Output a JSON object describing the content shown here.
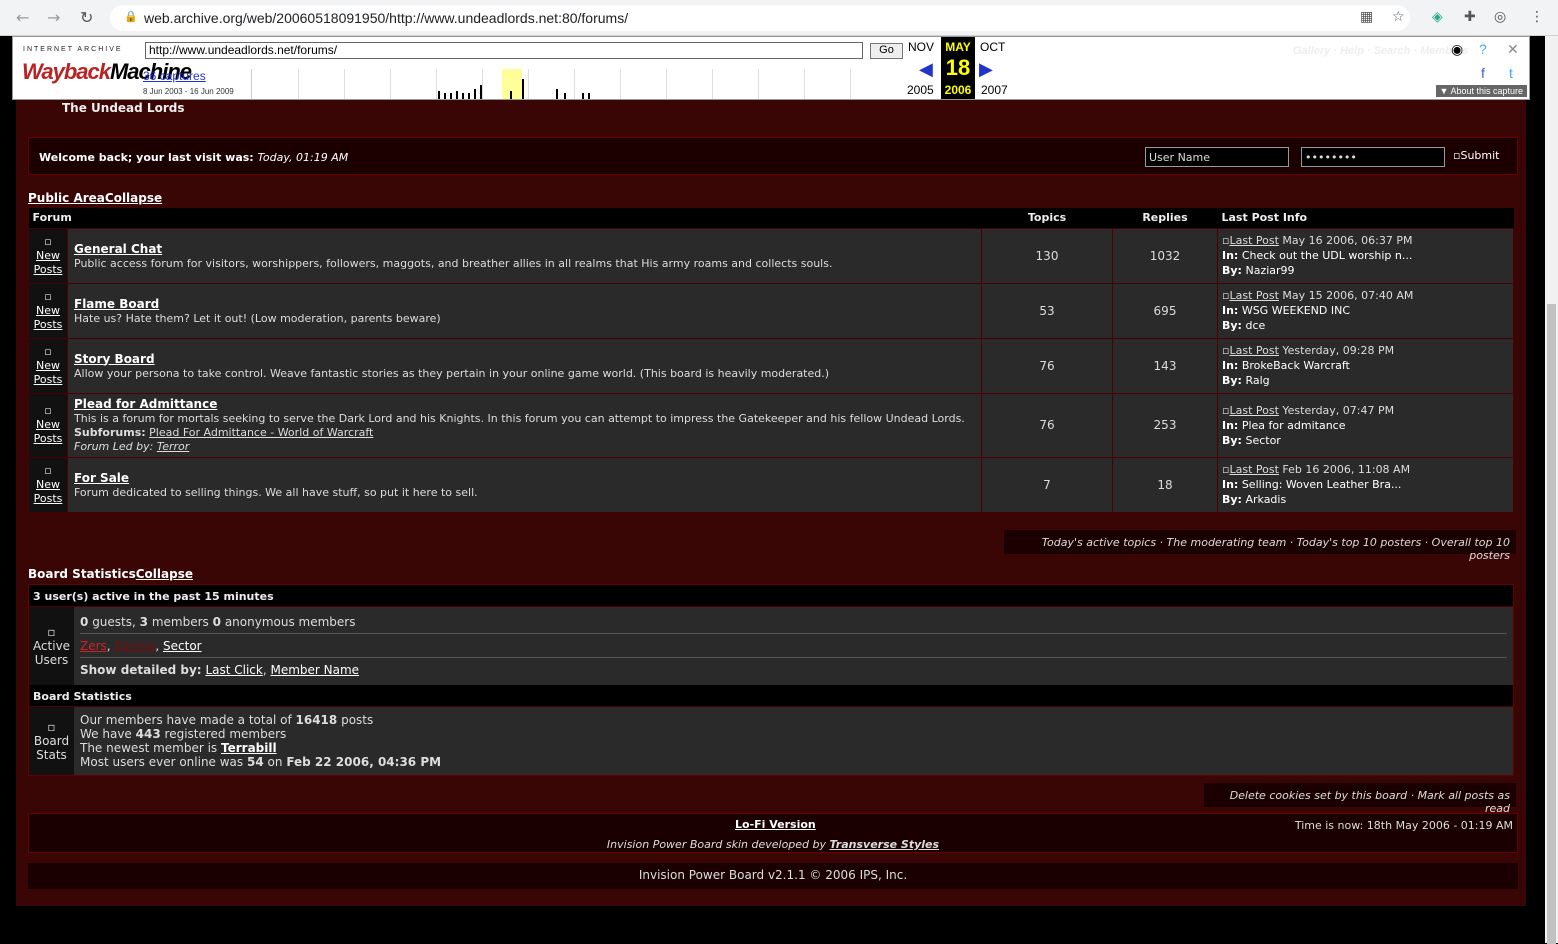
{
  "browser": {
    "url": "web.archive.org/web/20060518091950/http://www.undeadlords.net:80/forums/"
  },
  "wayback": {
    "ia_label": "INTERNET ARCHIVE",
    "logo_a": "Wayback",
    "logo_b": "Machine",
    "url_input": "http://www.undeadlords.net/forums/",
    "go": "Go",
    "captures": "36 captures",
    "range": "8 Jun 2003 - 16 Jun 2009",
    "prev_month": "NOV",
    "cur_month": "MAY",
    "next_month": "OCT",
    "cur_day": "18",
    "prev_year": "2005",
    "cur_year": "2006",
    "next_year": "2007",
    "about": "About this capture",
    "ghost_links": "Gallery · Help · Search · Members"
  },
  "forum": {
    "crumb": "The Undead Lords",
    "welcome_label": "Welcome back; your last visit was:",
    "welcome_time": "Today, 01:19 AM",
    "username_value": "User Name",
    "password_value": "••••••••",
    "submit": "Submit",
    "public_area": "Public Area",
    "collapse": "Collapse",
    "headers": {
      "forum": "Forum",
      "topics": "Topics",
      "replies": "Replies",
      "lastpost": "Last Post Info"
    },
    "icon_label_1": "New",
    "icon_label_2": "Posts",
    "last_post_label": "Last Post",
    "in_label": "In:",
    "by_label": "By:",
    "rows": [
      {
        "name": "General Chat",
        "desc": "Public access forum for visitors, worshippers, followers, maggots, and breather allies in all realms that His army roams and collects souls.",
        "topics": "130",
        "replies": "1032",
        "date": "May 16 2006, 06:37 PM",
        "topic": "Check out the UDL worship n...",
        "by": "Naziar99"
      },
      {
        "name": "Flame Board",
        "desc": "Hate us? Hate them? Let it out! (Low moderation, parents beware)",
        "topics": "53",
        "replies": "695",
        "date": "May 15 2006, 07:40 AM",
        "topic": "WSG WEEKEND INC",
        "by": "dce"
      },
      {
        "name": "Story Board",
        "desc": "Allow your persona to take control. Weave fantastic stories as they pertain in your online game world. (This board is heavily moderated.)",
        "topics": "76",
        "replies": "143",
        "date": "Yesterday, 09:28 PM",
        "topic": "BrokeBack Warcraft",
        "by": "Ralg"
      },
      {
        "name": "Plead for Admittance",
        "desc": "This is a forum for mortals seeking to serve the Dark Lord and his Knights. In this forum you can attempt to impress the Gatekeeper and his fellow Undead Lords.",
        "subforums_label": "Subforums:",
        "subforum": "Plead For Admittance - World of Warcraft",
        "led_label": "Forum Led by:",
        "led_by": "Terror",
        "topics": "76",
        "replies": "253",
        "date": "Yesterday, 07:47 PM",
        "topic": "Plea for admitance",
        "by": "Sector"
      },
      {
        "name": "For Sale",
        "desc": "Forum dedicated to selling things. We all have stuff, so put it here to sell.",
        "topics": "7",
        "replies": "18",
        "date": "Feb 16 2006, 11:08 AM",
        "topic": "Selling: Woven Leather Bra...",
        "by": "Arkadis"
      }
    ],
    "stat_links": "Today's active topics · The moderating team · Today's top 10 posters · Overall top 10 posters",
    "board_statistics": "Board Statistics",
    "active_head": "3 user(s) active in the past 15 minutes",
    "active_icon_1": "Active",
    "active_icon_2": "Users",
    "guests": "0",
    "guests_label": "guests,",
    "members": "3",
    "members_label": "members",
    "anon": "0",
    "anon_label": "anonymous members",
    "user1": "Zers",
    "user2": "Kanine",
    "user3": "Sector",
    "show_by": "Show detailed by:",
    "last_click": "Last Click",
    "member_name": "Member Name",
    "stats_head": "Board Statistics",
    "stats_icon_1": "Board",
    "stats_icon_2": "Stats",
    "s1_pre": "Our members have made a total of",
    "s1_val": "16418",
    "s1_post": "posts",
    "s2_pre": "We have",
    "s2_val": "443",
    "s2_post": "registered members",
    "s3_pre": "The newest member is",
    "s3_val": "Terrabill",
    "s4_pre": "Most users ever online was",
    "s4_val": "54",
    "s4_mid": "on",
    "s4_date": "Feb 22 2006, 04:36 PM",
    "footer_links": "Delete cookies set by this board · Mark all posts as read",
    "lofi": "Lo-Fi Version",
    "time_now": "Time is now: 18th May 2006 - 01:19 AM",
    "skin_pre": "Invision Power Board skin developed by",
    "skin_by": "Transverse Styles",
    "powered": "Invision Power Board v2.1.1 © 2006  IPS, Inc."
  },
  "colors": {
    "page_bg": "#3a0505",
    "accent_red": "#cc2222"
  }
}
